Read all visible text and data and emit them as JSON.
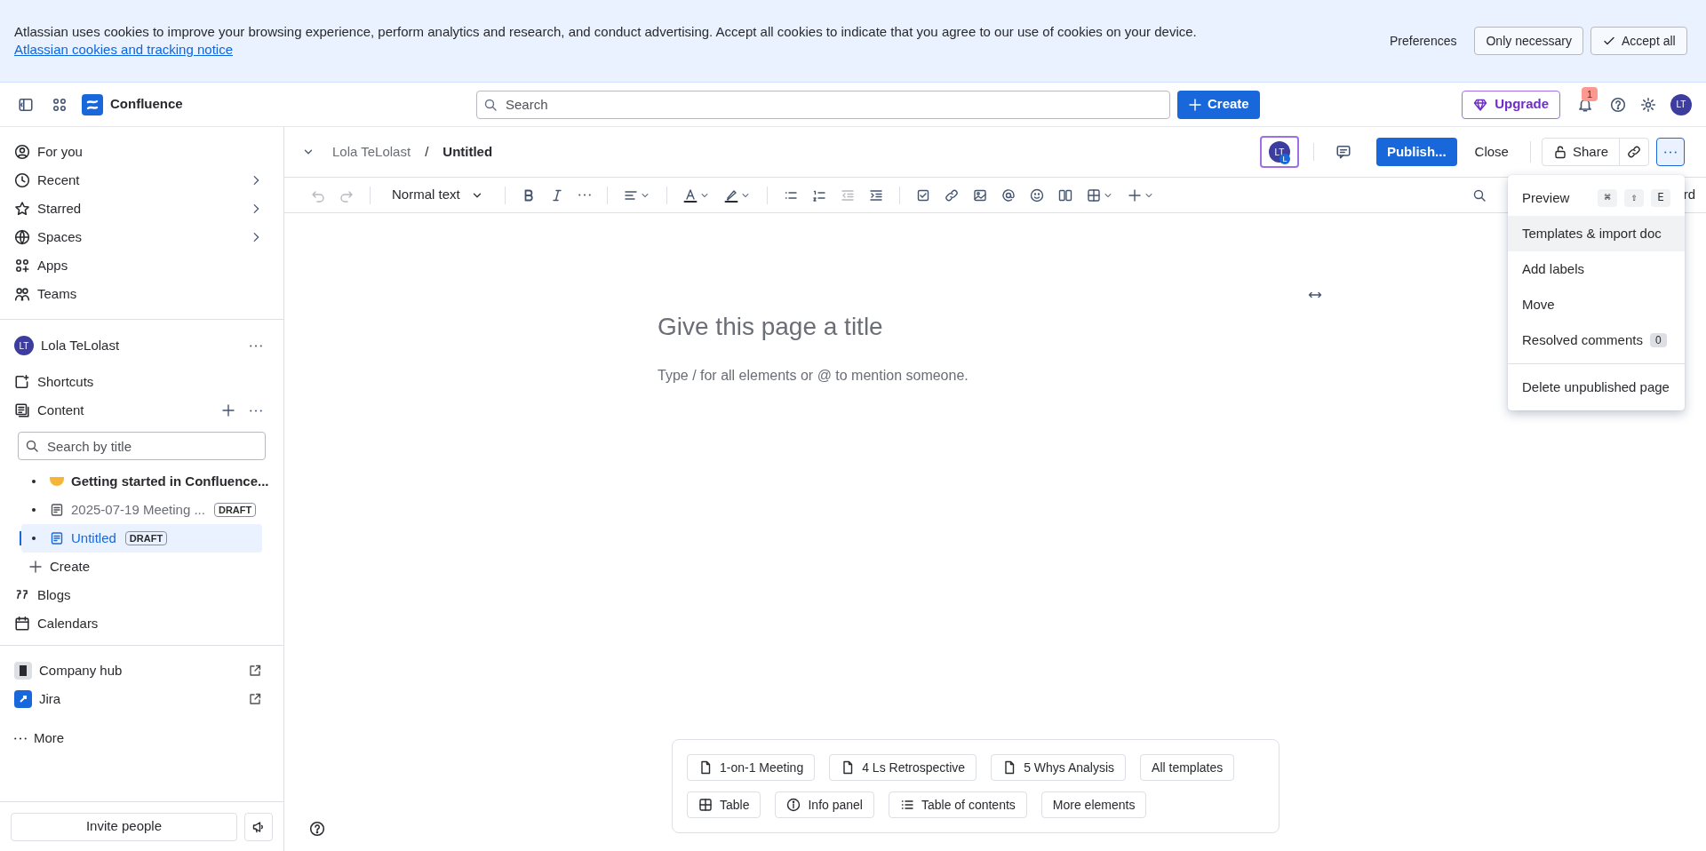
{
  "cookie_banner": {
    "message": "Atlassian uses cookies to improve your browsing experience, perform analytics and research, and conduct advertising. Accept all cookies to indicate that you agree to our use of cookies on your device.",
    "link": "Atlassian cookies and tracking notice",
    "buttons": [
      {
        "label": "Preferences",
        "kind": "subtle"
      },
      {
        "label": "Only necessary",
        "kind": "outline"
      },
      {
        "label": "Accept all",
        "kind": "accept"
      }
    ]
  },
  "top_nav": {
    "product": "Confluence",
    "search": {
      "placeholder": "Search"
    },
    "create": "Create",
    "upgrade": "Upgrade",
    "notification_count": "1",
    "avatar": "LT"
  },
  "sidebar": {
    "nav_items": [
      {
        "label": "For you",
        "expandable": false
      },
      {
        "label": "Recent",
        "expandable": true
      },
      {
        "label": "Starred",
        "expandable": true
      },
      {
        "label": "Spaces",
        "expandable": true
      },
      {
        "label": "Apps",
        "expandable": false
      },
      {
        "label": "Teams",
        "expandable": false
      }
    ],
    "space": {
      "avatar": "LT",
      "name": "Lola TeLolast"
    },
    "sections": [
      "Shortcuts",
      "Content"
    ],
    "search": {
      "placeholder": "Search by title"
    },
    "tree": [
      {
        "label": "Getting started in Confluence...",
        "kind": "emoji",
        "selected": false
      },
      {
        "label": "2025-07-19 Meeting ...",
        "kind": "page",
        "badge": "DRAFT",
        "selected": false
      },
      {
        "label": "Untitled",
        "kind": "page",
        "badge": "DRAFT",
        "selected": true
      }
    ],
    "create": "Create",
    "more_items": [
      "Blogs",
      "Calendars"
    ],
    "apps": [
      "Company hub",
      "Jira"
    ],
    "more": "More",
    "invite": "Invite people"
  },
  "editor": {
    "breadcrumb": [
      "Lola TeLolast",
      "Untitled"
    ],
    "breadcrumb_separator": "/",
    "avatar": "LT",
    "avatar_badge": "L",
    "publish": "Publish...",
    "close": "Close",
    "share": "Share",
    "toolbar": {
      "text_style": "Normal text",
      "cut_text": "rd"
    },
    "title_placeholder": "Give this page a title",
    "body_placeholder": "Type / for all elements or @ to mention someone.",
    "templates": [
      {
        "label": "1-on-1 Meeting",
        "kind": "template"
      },
      {
        "label": "4 Ls Retrospective",
        "kind": "template"
      },
      {
        "label": "5 Whys Analysis",
        "kind": "template"
      },
      {
        "label": "All templates",
        "kind": "plain"
      }
    ],
    "elements": [
      {
        "label": "Table",
        "kind": "table"
      },
      {
        "label": "Info panel",
        "kind": "info"
      },
      {
        "label": "Table of contents",
        "kind": "toc"
      },
      {
        "label": "More elements",
        "kind": "plain"
      }
    ]
  },
  "more_menu": {
    "items": [
      {
        "label": "Preview",
        "keys": [
          "⌘",
          "⇧",
          "E"
        ],
        "selected": false
      },
      {
        "label": "Templates & import doc",
        "selected": true
      },
      {
        "label": "Add labels",
        "selected": false
      },
      {
        "label": "Move",
        "selected": false
      },
      {
        "label": "Resolved comments",
        "count": "0",
        "selected": false
      },
      {
        "label": "Delete unpublished page",
        "divider_before": true,
        "selected": false
      }
    ]
  }
}
